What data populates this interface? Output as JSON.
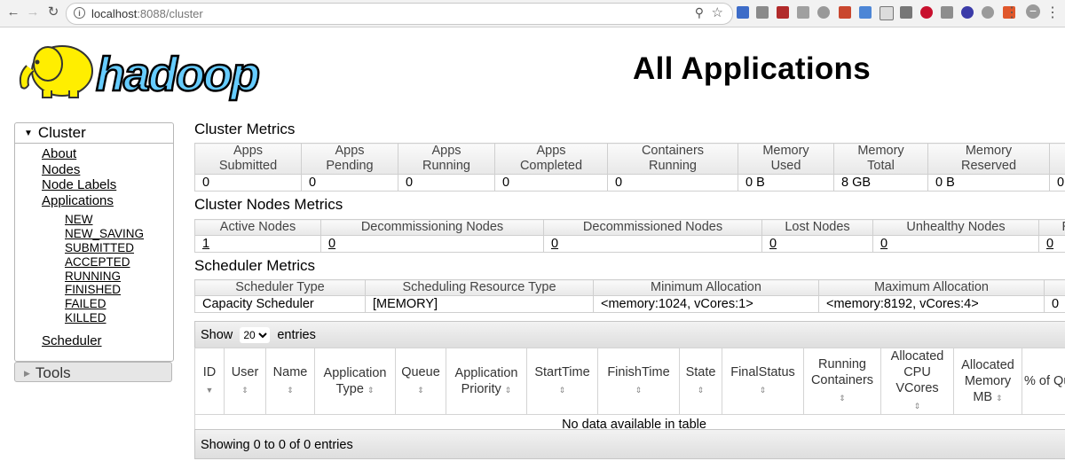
{
  "browser": {
    "url_host": "localhost",
    "url_path": ":8088/cluster"
  },
  "header": {
    "logo_text": "hadoop",
    "title": "All Applications"
  },
  "sidebar": {
    "cluster_label": "Cluster",
    "links": [
      "About",
      "Nodes",
      "Node Labels",
      "Applications"
    ],
    "app_states": [
      "NEW",
      "NEW_SAVING",
      "SUBMITTED",
      "ACCEPTED",
      "RUNNING",
      "FINISHED",
      "FAILED",
      "KILLED"
    ],
    "scheduler": "Scheduler",
    "tools_label": "Tools"
  },
  "cluster_metrics": {
    "title": "Cluster Metrics",
    "headers": [
      [
        "Apps",
        "Submitted"
      ],
      [
        "Apps",
        "Pending"
      ],
      [
        "Apps",
        "Running"
      ],
      [
        "Apps",
        "Completed"
      ],
      [
        "Containers",
        "Running"
      ],
      [
        "Memory",
        "Used"
      ],
      [
        "Memory",
        "Total"
      ],
      [
        "Memory",
        "Reserved"
      ]
    ],
    "values": [
      "0",
      "0",
      "0",
      "0",
      "0",
      "0 B",
      "8 GB",
      "0 B",
      "0"
    ]
  },
  "node_metrics": {
    "title": "Cluster Nodes Metrics",
    "headers": [
      "Active Nodes",
      "Decommissioning Nodes",
      "Decommissioned Nodes",
      "Lost Nodes",
      "Unhealthy Nodes",
      "R"
    ],
    "values": [
      "1",
      "0",
      "0",
      "0",
      "0",
      "0"
    ]
  },
  "scheduler_metrics": {
    "title": "Scheduler Metrics",
    "headers": [
      "Scheduler Type",
      "Scheduling Resource Type",
      "Minimum Allocation",
      "Maximum Allocation"
    ],
    "values": [
      "Capacity Scheduler",
      "[MEMORY]",
      "<memory:1024, vCores:1>",
      "<memory:8192, vCores:4>",
      "0"
    ]
  },
  "apps_table": {
    "show_label": "Show",
    "entries_value": "20",
    "entries_label": "entries",
    "columns": [
      "ID",
      "User",
      "Name",
      "Application Type",
      "Queue",
      "Application Priority",
      "StartTime",
      "FinishTime",
      "State",
      "FinalStatus",
      "Running Containers",
      "Allocated CPU VCores",
      "Allocated Memory MB",
      "% of Queue"
    ],
    "empty_message": "No data available in table",
    "footer": "Showing 0 to 0 of 0 entries"
  }
}
